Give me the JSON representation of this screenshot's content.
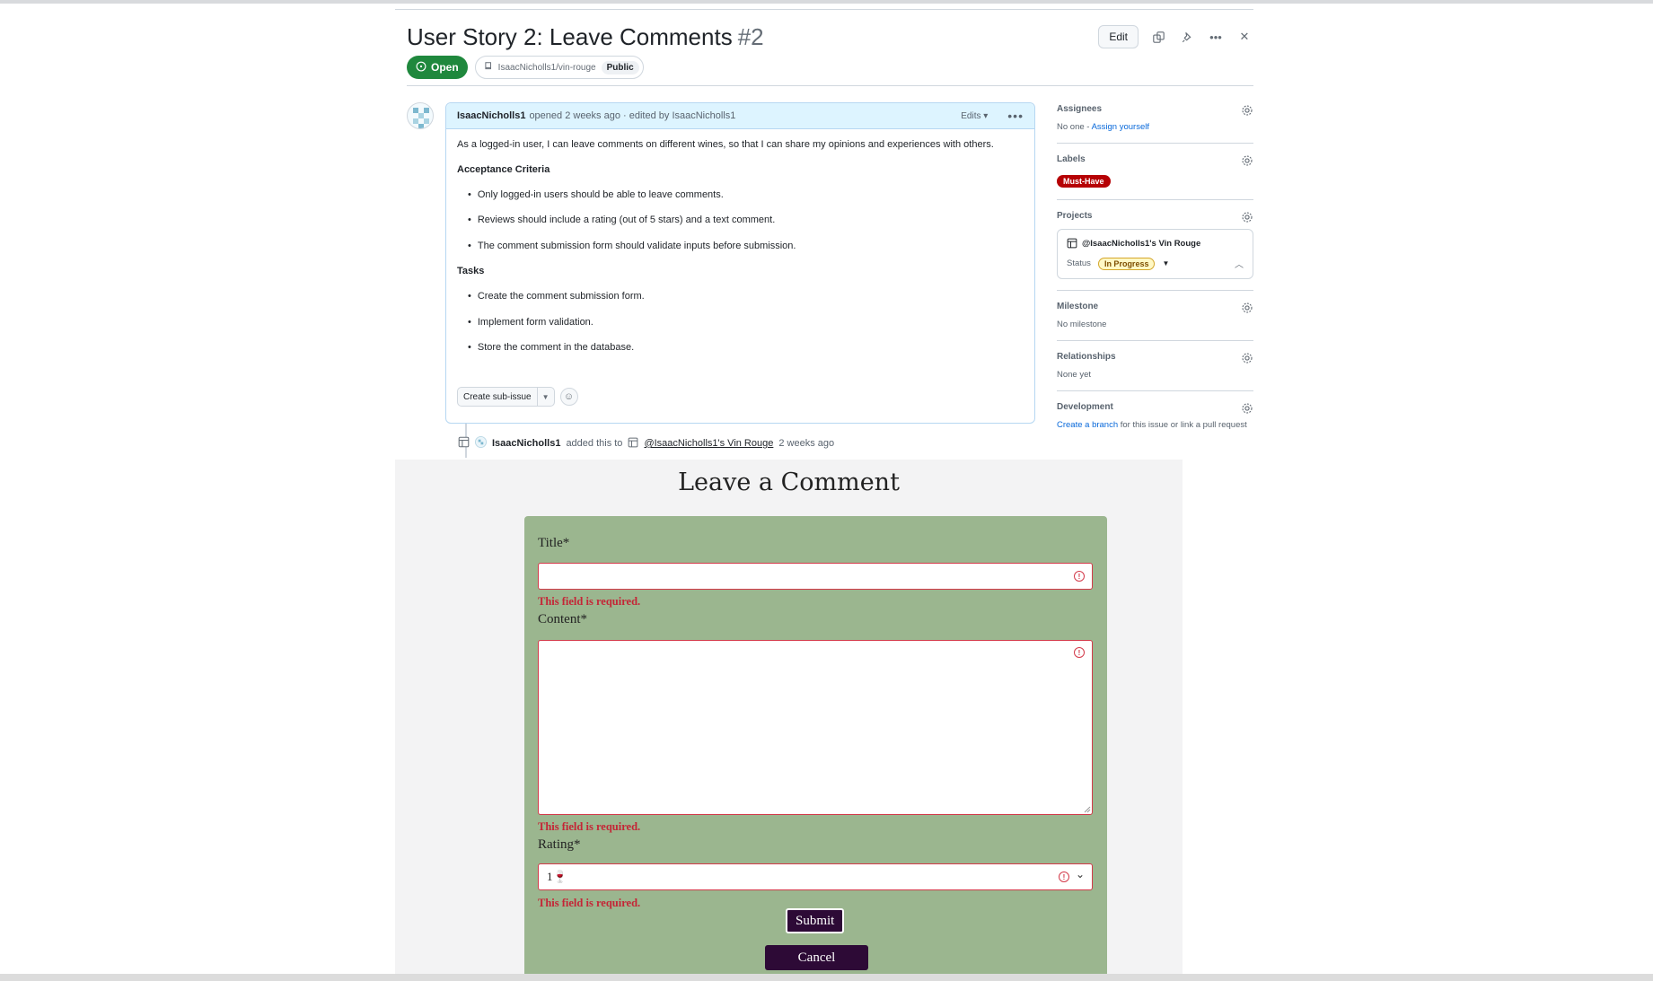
{
  "issue": {
    "title": "User Story 2: Leave Comments",
    "number": "#2",
    "state": "Open",
    "repo": "IsaacNicholls1/vin-rouge",
    "visibility": "Public",
    "actions": {
      "edit": "Edit"
    }
  },
  "comment": {
    "author": "IsaacNicholls1",
    "meta": "opened 2 weeks ago · edited by IsaacNicholls1",
    "edits_label": "Edits",
    "intro": "As a logged-in user, I can leave comments on different wines, so that I can share my opinions and experiences with others.",
    "acceptance_heading": "Acceptance Criteria",
    "acceptance": [
      "Only logged-in users should be able to leave comments.",
      "Reviews should include a rating (out of 5 stars) and a text comment.",
      "The comment submission form should validate inputs before submission."
    ],
    "tasks_heading": "Tasks",
    "tasks": [
      "Create the comment submission form.",
      "Implement form validation.",
      "Store the comment in the database."
    ],
    "create_sub_issue": "Create sub-issue"
  },
  "timeline": {
    "who": "IsaacNicholls1",
    "action": "added this to",
    "project": "@IsaacNicholls1's Vin Rouge",
    "when": "2 weeks ago"
  },
  "sidebar": {
    "assignees": {
      "title": "Assignees",
      "text": "No one - ",
      "link": "Assign yourself"
    },
    "labels": {
      "title": "Labels",
      "label": "Must-Have",
      "label_color": "#b60205"
    },
    "projects": {
      "title": "Projects",
      "project": "@IsaacNicholls1's Vin Rouge",
      "status_label": "Status",
      "status": "In Progress"
    },
    "milestone": {
      "title": "Milestone",
      "text": "No milestone"
    },
    "relationships": {
      "title": "Relationships",
      "text": "None yet"
    },
    "development": {
      "title": "Development",
      "link": "Create a branch",
      "text": " for this issue or link a pull request"
    }
  },
  "form": {
    "heading": "Leave a Comment",
    "title_label": "Title*",
    "content_label": "Content*",
    "rating_label": "Rating*",
    "rating_value": "1🍷",
    "error": "This field is required.",
    "submit": "Submit",
    "cancel": "Cancel",
    "card_color": "#9bb68f",
    "button_color": "#2d0a36"
  }
}
